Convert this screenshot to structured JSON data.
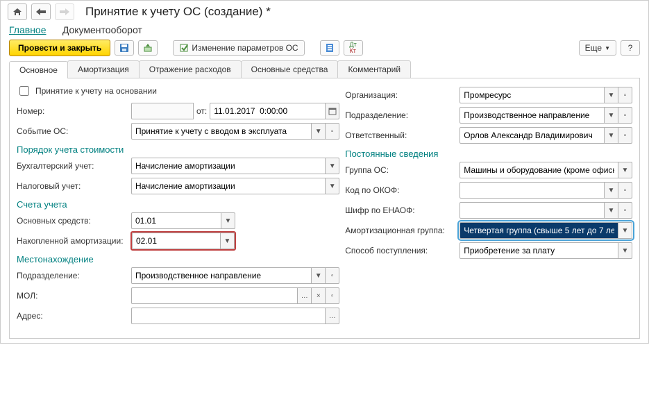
{
  "title": "Принятие к учету ОС (создание) *",
  "main_tabs": {
    "main": "Главное",
    "docflow": "Документооборот"
  },
  "toolbar": {
    "post_close": "Провести и закрыть",
    "change_params": "Изменение параметров ОС",
    "more": "Еще",
    "help": "?"
  },
  "tabs": {
    "main": "Основное",
    "amort": "Амортизация",
    "expenses": "Отражение расходов",
    "assets": "Основные средства",
    "comment": "Комментарий"
  },
  "left": {
    "chk_label": "Принятие к учету на основании",
    "number_lbl": "Номер:",
    "number_val": "",
    "from_lbl": "от:",
    "date_val": "11.01.2017  0:00:00",
    "event_lbl": "Событие ОС:",
    "event_val": "Принятие к учету с вводом в эксплуата",
    "sec_cost": "Порядок учета стоимости",
    "buh_lbl": "Бухгалтерский учет:",
    "buh_val": "Начисление амортизации",
    "tax_lbl": "Налоговый учет:",
    "tax_val": "Начисление амортизации",
    "sec_accounts": "Счета учета",
    "asset_acc_lbl": "Основных средств:",
    "asset_acc_val": "01.01",
    "amort_acc_lbl": "Накопленной амортизации:",
    "amort_acc_val": "02.01",
    "sec_location": "Местонахождение",
    "dept_lbl": "Подразделение:",
    "dept_val": "Производственное направление",
    "mol_lbl": "МОЛ:",
    "mol_val": "",
    "addr_lbl": "Адрес:",
    "addr_val": ""
  },
  "right": {
    "org_lbl": "Организация:",
    "org_val": "Промресурс",
    "dept_lbl": "Подразделение:",
    "dept_val": "Производственное направление",
    "resp_lbl": "Ответственный:",
    "resp_val": "Орлов Александр Владимирович",
    "sec_const": "Постоянные сведения",
    "group_lbl": "Группа ОС:",
    "group_val": "Машины и оборудование (кроме офисн",
    "okof_lbl": "Код по ОКОФ:",
    "okof_val": "",
    "enaof_lbl": "Шифр по ЕНАОФ:",
    "enaof_val": "",
    "amgrp_lbl": "Амортизационная группа:",
    "amgrp_val": "Четвертая группа (свыше 5 лет до 7 ле",
    "method_lbl": "Способ поступления:",
    "method_val": "Приобретение за плату"
  }
}
